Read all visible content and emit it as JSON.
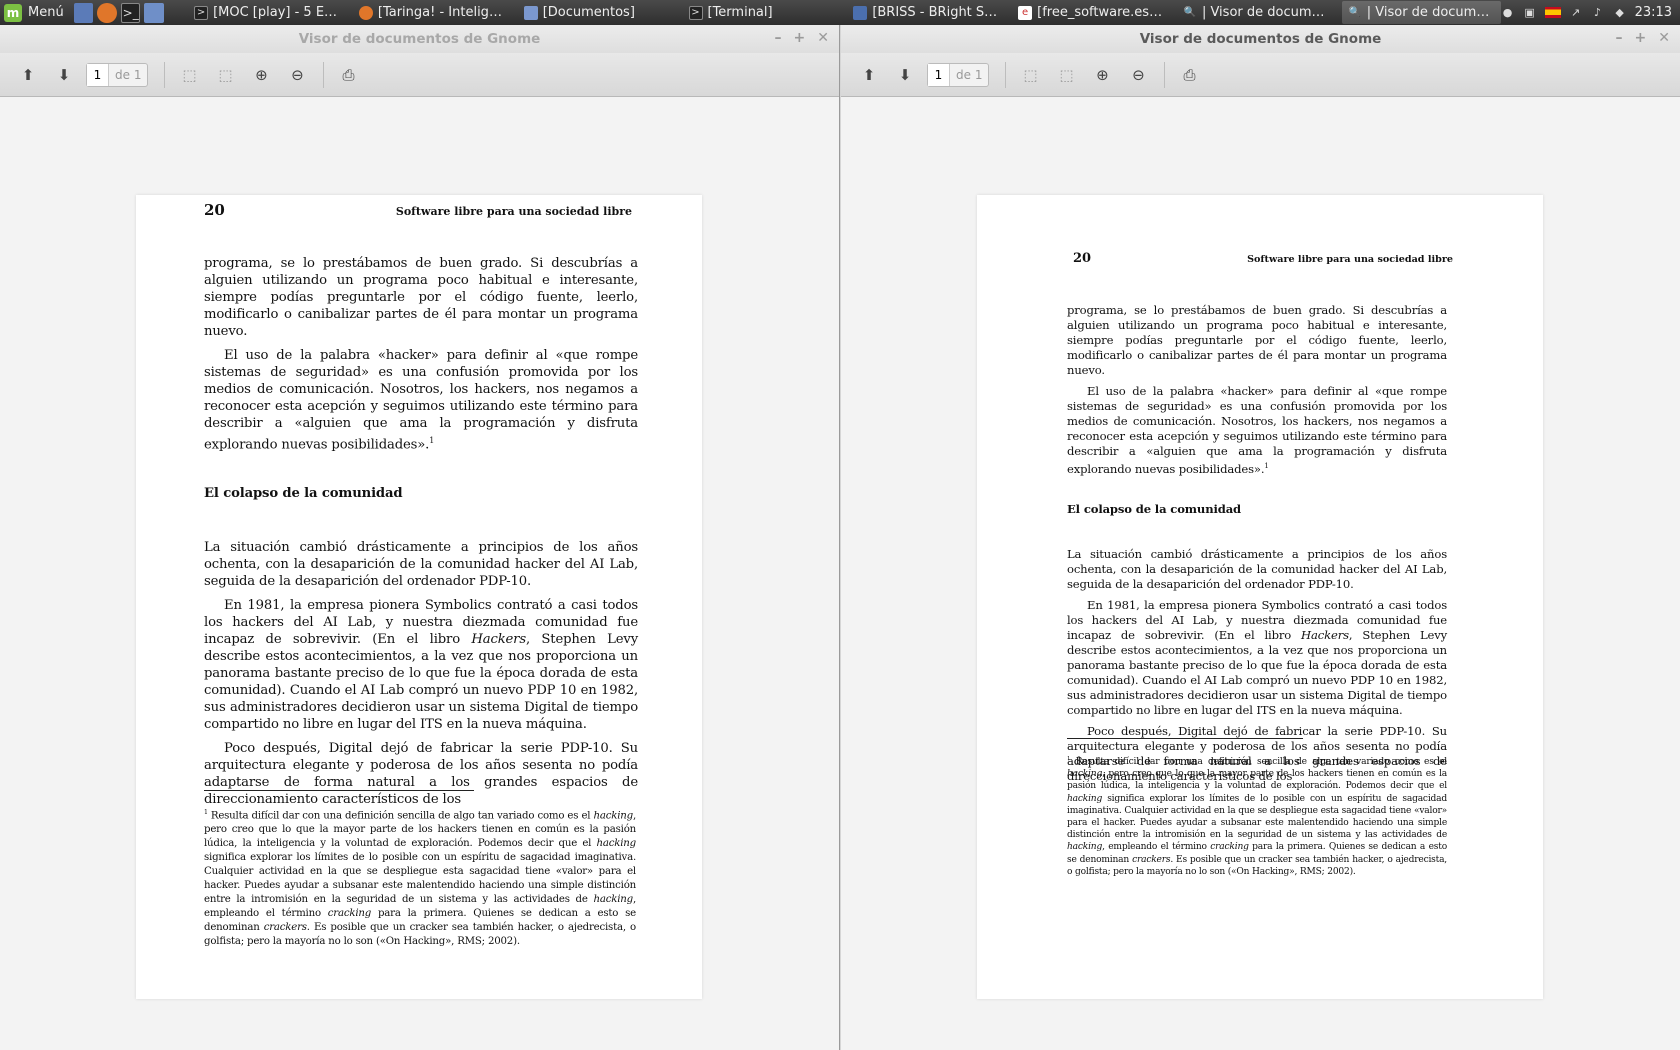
{
  "taskbar": {
    "menu_label": "Menú",
    "tasks": [
      {
        "label": "[MOC [play] - 5 EGOI...",
        "icon": "terminal-icon"
      },
      {
        "label": "[Taringa! - Inteligenci...",
        "icon": "firefox-icon"
      },
      {
        "label": "[Documentos]",
        "icon": "folder-icon"
      },
      {
        "label": "[Terminal]",
        "icon": "terminal-icon"
      },
      {
        "label": "[BRISS - BRight Snipp...",
        "icon": "app-icon"
      },
      {
        "label": "[free_software.es.pdf...",
        "icon": "pdf-icon"
      },
      {
        "label": "| Visor de documento...",
        "icon": "evince-icon"
      },
      {
        "label": "| Visor de documento...",
        "icon": "evince-icon",
        "active": true
      }
    ],
    "clock": "23:13"
  },
  "left_window": {
    "title": "Visor de documentos de Gnome",
    "page_input": "1",
    "page_of": "de 1"
  },
  "right_window": {
    "title": "Visor de documentos de Gnome",
    "page_input": "1",
    "page_of": "de 1"
  },
  "document": {
    "page_number": "20",
    "running_head": "Software libre para una sociedad libre",
    "p1": "programa, se lo prestábamos de buen grado. Si descubrías a alguien utilizando un programa poco habitual e interesante, siempre podías preguntarle por el código fuente, leerlo, modificarlo o canibalizar partes de él para montar un programa nuevo.",
    "p2": "El uso de la palabra «hacker» para definir al «que rompe sistemas de seguridad» es una confusión promovida por los medios de comunicación. Nosotros, los hackers, nos negamos a reconocer esta acepción y seguimos utilizando este término para describir a «alguien que ama la programación y disfruta explorando nuevas posibilidades».",
    "p2_footnote_mark": "1",
    "heading": "El colapso de la comunidad",
    "p3": "La situación cambió drásticamente a principios de los años ochenta, con la desaparición de la comunidad hacker del AI Lab, seguida de la desaparición del ordenador PDP-10.",
    "p4_a": "En 1981, la empresa pionera Symbolics contrató a casi todos los hackers del AI Lab, y nuestra diezmada comunidad fue incapaz de sobrevivir. (En el libro ",
    "p4_italic": "Hackers",
    "p4_b": ", Stephen Levy describe estos acontecimientos, a la vez que nos proporciona un panorama bastante preciso de lo que fue la época dorada de esta comunidad). Cuando el AI Lab compró un nuevo PDP 10 en 1982, sus administradores decidieron usar un sistema Digital de tiempo compartido no libre en lugar del ITS en la nueva máquina.",
    "p5": "Poco después, Digital dejó de fabricar la serie PDP-10. Su arquitectura elegante y poderosa de los años sesenta no podía adaptarse de forma natural a los grandes espacios de direccionamiento característicos de los",
    "fn_mark": "1",
    "fn_a": "Resulta difícil dar con una definición sencilla de algo tan variado como es el ",
    "fn_i1": "hacking",
    "fn_b": ", pero creo que lo que la mayor parte de los hackers tienen en común es la pasión lúdica, la inteligencia y la voluntad de exploración. Podemos decir que el ",
    "fn_i2": "hacking",
    "fn_c": " significa explorar los límites de lo posible con un espíritu de sagacidad imaginativa. Cualquier actividad en la que se despliegue esta sagacidad tiene «valor» para el hacker. Puedes ayudar a subsanar este malentendido haciendo una simple distinción entre la intromisión en la seguridad de un sistema y las actividades de ",
    "fn_i3": "hacking",
    "fn_d": ", empleando el término ",
    "fn_i4": "cracking",
    "fn_e": " para la primera. Quienes se dedican a esto se denominan ",
    "fn_i5": "crackers",
    "fn_f": ". Es posible que un cracker sea también hacker, o ajedrecista, o golfista; pero la mayoría no lo son («On Hacking», RMS; 2002)."
  },
  "colors": {
    "taskbar_bg": "#3a3a3a",
    "window_bg": "#f3f3f3",
    "mint_green": "#7cc043"
  }
}
